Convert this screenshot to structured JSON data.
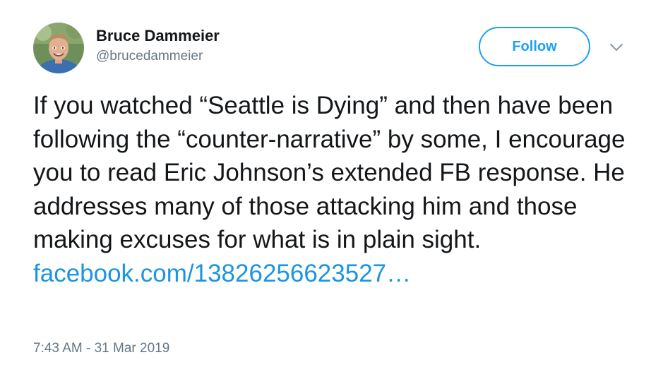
{
  "author": {
    "display_name": "Bruce Dammeier",
    "handle": "@brucedammeier",
    "avatar_icon": "profile-photo"
  },
  "actions": {
    "follow_label": "Follow",
    "more_icon": "chevron-down-icon"
  },
  "tweet": {
    "text": "If you watched “Seattle is Dying” and then have been following the “counter-narrative” by some, I encourage you to read Eric Johnson’s extended FB response.  He addresses many of those attacking him and those making excuses for what is in plain sight.",
    "link_text": "facebook.com/13826256623527…",
    "timestamp": "7:43 AM - 31 Mar 2019"
  },
  "colors": {
    "accent": "#1da1f2",
    "link": "#1b95e0",
    "text": "#14171a",
    "secondary": "#657786"
  }
}
